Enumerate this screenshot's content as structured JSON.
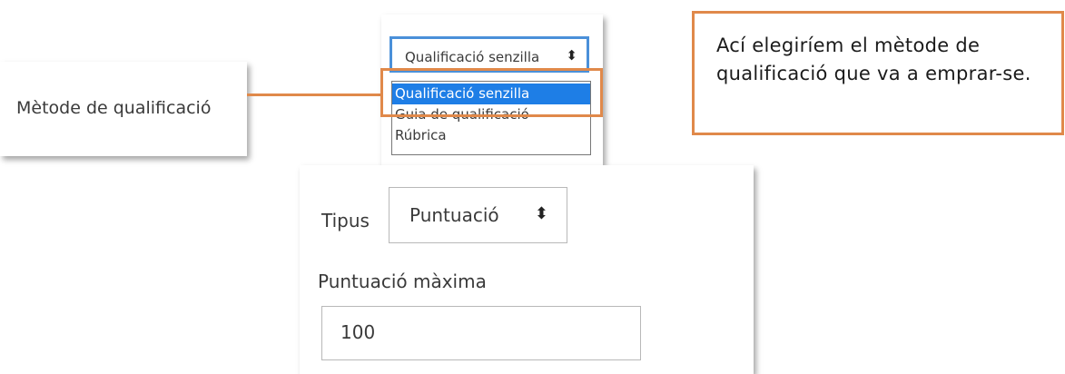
{
  "grading_method": {
    "label": "Mètode de qualificació",
    "selected": "Qualificació senzilla",
    "options": [
      "Qualificació senzilla",
      "Guia de qualificació",
      "Rúbrica"
    ],
    "highlighted_option": "Qualificació senzilla"
  },
  "callout": {
    "text": "Ací elegiríem el mètode de qualificació que va a emprar-se."
  },
  "form": {
    "type_label": "Tipus",
    "type_value": "Puntuació",
    "max_label": "Puntuació màxima",
    "max_value": "100"
  },
  "icons": {
    "select_arrow": "sort-updown-icon"
  },
  "colors": {
    "accent_orange": "#e0894a",
    "select_focus_blue": "#4a90d9",
    "option_selected_bg": "#1e7ee6"
  }
}
